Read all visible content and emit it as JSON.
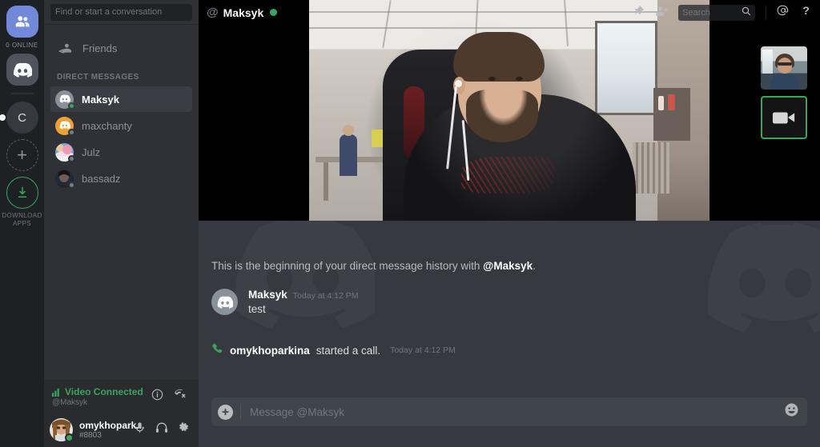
{
  "app": {
    "name": "Discord"
  },
  "rail": {
    "friends_label": "Friends",
    "online_count": "0 ONLINE",
    "home_label": "Discord Home",
    "server_initial": "C",
    "add_label": "+",
    "download_line1": "DOWNLOAD",
    "download_line2": "APPS"
  },
  "sidebar": {
    "search_placeholder": "Find or start a conversation",
    "friends_label": "Friends",
    "dm_header": "DIRECT MESSAGES",
    "dms": [
      {
        "name": "Maksyk",
        "status": "online",
        "active": true
      },
      {
        "name": "maxchanty",
        "status": "offline",
        "active": false
      },
      {
        "name": "Julz",
        "status": "offline",
        "active": false
      },
      {
        "name": "bassadz",
        "status": "offline",
        "active": false
      }
    ],
    "voice": {
      "status": "Video Connected",
      "channel": "@Maksyk",
      "accent_color": "#3ba55d",
      "info_icon": "info-icon",
      "disconnect_icon": "disconnect-call-icon"
    },
    "user": {
      "name": "omykhopark...",
      "tag": "#8803",
      "status": "online",
      "mic_icon": "microphone-icon",
      "headphones_icon": "headphones-icon",
      "settings_icon": "gear-icon"
    }
  },
  "header": {
    "at_symbol": "@",
    "title": "Maksyk",
    "status": "online",
    "status_color": "#3ba55d",
    "pin_icon": "pin-icon",
    "add_friend_icon": "add-friend-icon",
    "search_placeholder": "Search",
    "search_icon": "search-icon",
    "mentions_icon": "mentions-icon",
    "help_icon": "help-icon"
  },
  "call": {
    "main_participant": "Maksyk",
    "thumbnails": [
      {
        "name": "self-video-thumbnail",
        "active": false
      },
      {
        "name": "camera-tile",
        "active": true,
        "border_color": "#3ba55d",
        "icon": "video-camera-icon"
      }
    ]
  },
  "messages": {
    "beginning_text_prefix": "This is the beginning of your direct message history with ",
    "beginning_mention": "@Maksyk",
    "beginning_text_suffix": ".",
    "items": [
      {
        "author": "Maksyk",
        "timestamp": "Today at 4:12 PM",
        "text": "test",
        "type": "message"
      }
    ],
    "system": {
      "icon": "phone-icon",
      "icon_color": "#3ba55d",
      "author": "omykhoparkina",
      "text": "started a call.",
      "timestamp": "Today at 4:12 PM"
    }
  },
  "composer": {
    "attach_icon": "plus-icon",
    "placeholder": "Message @Maksyk",
    "emoji_icon": "emoji-icon"
  }
}
